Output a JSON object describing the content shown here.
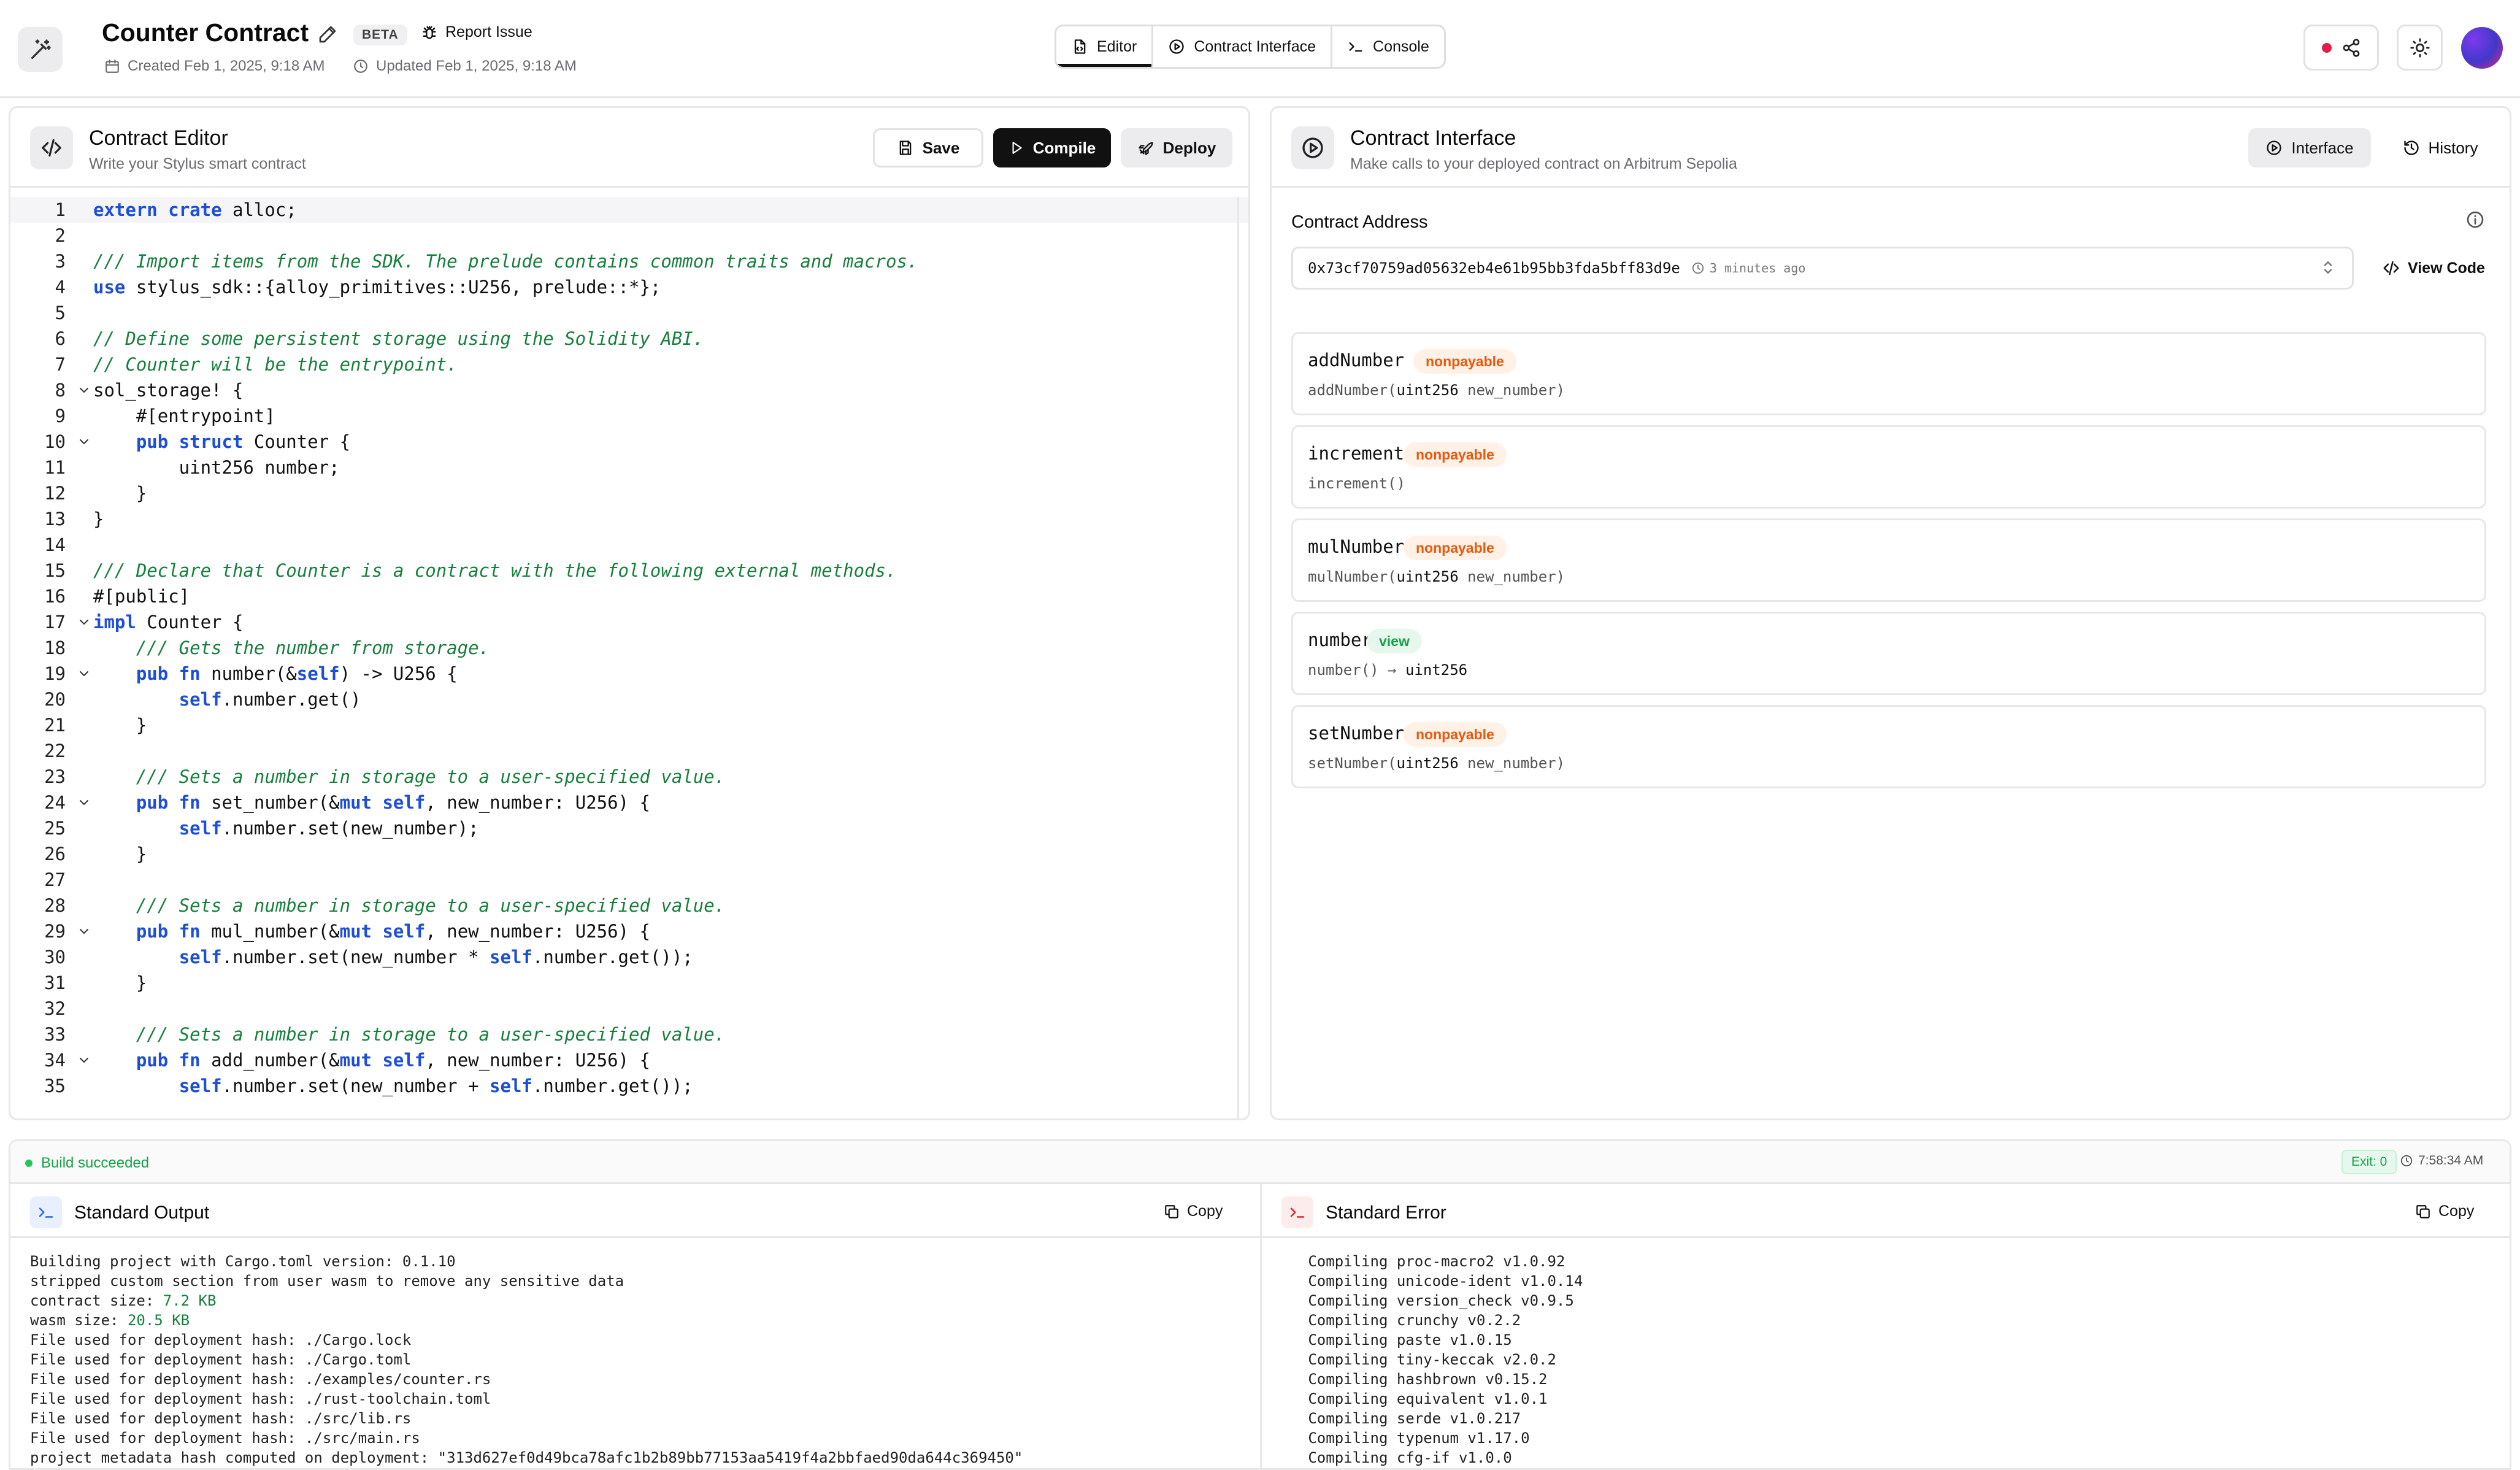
{
  "header": {
    "title": "Counter Contract",
    "beta": "BETA",
    "report_issue": "Report Issue",
    "created": "Created Feb 1, 2025, 9:18 AM",
    "updated": "Updated Feb 1, 2025, 9:18 AM",
    "tabs": [
      {
        "label": "Editor",
        "active": true
      },
      {
        "label": "Contract Interface",
        "active": false
      },
      {
        "label": "Console",
        "active": false
      }
    ]
  },
  "editor": {
    "title": "Contract Editor",
    "subtitle": "Write your Stylus smart contract",
    "save": "Save",
    "compile": "Compile",
    "deploy": "Deploy",
    "lines": [
      {
        "n": "1",
        "fold": false,
        "html": "<span class=\"kw\">extern</span> <span class=\"kw\">crate</span> alloc;"
      },
      {
        "n": "2",
        "fold": false,
        "html": ""
      },
      {
        "n": "3",
        "fold": false,
        "html": "<span class=\"cm\">/// Import items from the SDK. The prelude contains common traits and macros.</span>"
      },
      {
        "n": "4",
        "fold": false,
        "html": "<span class=\"kw\">use</span> stylus_sdk::{alloy_primitives::U256, prelude::*};"
      },
      {
        "n": "5",
        "fold": false,
        "html": ""
      },
      {
        "n": "6",
        "fold": false,
        "html": "<span class=\"cm\">// Define some persistent storage using the Solidity ABI.</span>"
      },
      {
        "n": "7",
        "fold": false,
        "html": "<span class=\"cm\">// Counter will be the entrypoint.</span>"
      },
      {
        "n": "8",
        "fold": true,
        "html": "sol_storage! {"
      },
      {
        "n": "9",
        "fold": false,
        "html": "    #[entrypoint]"
      },
      {
        "n": "10",
        "fold": true,
        "html": "    <span class=\"kw\">pub</span> <span class=\"kw\">struct</span> Counter {"
      },
      {
        "n": "11",
        "fold": false,
        "html": "        uint256 number;"
      },
      {
        "n": "12",
        "fold": false,
        "html": "    }"
      },
      {
        "n": "13",
        "fold": false,
        "html": "}"
      },
      {
        "n": "14",
        "fold": false,
        "html": ""
      },
      {
        "n": "15",
        "fold": false,
        "html": "<span class=\"cm\">/// Declare that Counter is a contract with the following external methods.</span>"
      },
      {
        "n": "16",
        "fold": false,
        "html": "#[public]"
      },
      {
        "n": "17",
        "fold": true,
        "html": "<span class=\"kw\">impl</span> Counter {"
      },
      {
        "n": "18",
        "fold": false,
        "html": "    <span class=\"cm\">/// Gets the number from storage.</span>"
      },
      {
        "n": "19",
        "fold": true,
        "html": "    <span class=\"kw\">pub</span> <span class=\"kw\">fn</span> number(&amp;<span class=\"kw\">self</span>) -&gt; U256 {"
      },
      {
        "n": "20",
        "fold": false,
        "html": "        <span class=\"kw\">self</span>.number.get()"
      },
      {
        "n": "21",
        "fold": false,
        "html": "    }"
      },
      {
        "n": "22",
        "fold": false,
        "html": ""
      },
      {
        "n": "23",
        "fold": false,
        "html": "    <span class=\"cm\">/// Sets a number in storage to a user-specified value.</span>"
      },
      {
        "n": "24",
        "fold": true,
        "html": "    <span class=\"kw\">pub</span> <span class=\"kw\">fn</span> set_number(&amp;<span class=\"kw\">mut</span> <span class=\"kw\">self</span>, new_number: U256) {"
      },
      {
        "n": "25",
        "fold": false,
        "html": "        <span class=\"kw\">self</span>.number.set(new_number);"
      },
      {
        "n": "26",
        "fold": false,
        "html": "    }"
      },
      {
        "n": "27",
        "fold": false,
        "html": ""
      },
      {
        "n": "28",
        "fold": false,
        "html": "    <span class=\"cm\">/// Sets a number in storage to a user-specified value.</span>"
      },
      {
        "n": "29",
        "fold": true,
        "html": "    <span class=\"kw\">pub</span> <span class=\"kw\">fn</span> mul_number(&amp;<span class=\"kw\">mut</span> <span class=\"kw\">self</span>, new_number: U256) {"
      },
      {
        "n": "30",
        "fold": false,
        "html": "        <span class=\"kw\">self</span>.number.set(new_number * <span class=\"kw\">self</span>.number.get());"
      },
      {
        "n": "31",
        "fold": false,
        "html": "    }"
      },
      {
        "n": "32",
        "fold": false,
        "html": ""
      },
      {
        "n": "33",
        "fold": false,
        "html": "    <span class=\"cm\">/// Sets a number in storage to a user-specified value.</span>"
      },
      {
        "n": "34",
        "fold": true,
        "html": "    <span class=\"kw\">pub</span> <span class=\"kw\">fn</span> add_number(&amp;<span class=\"kw\">mut</span> <span class=\"kw\">self</span>, new_number: U256) {"
      },
      {
        "n": "35",
        "fold": false,
        "html": "        <span class=\"kw\">self</span>.number.set(new_number + <span class=\"kw\">self</span>.number.get());"
      }
    ]
  },
  "interface": {
    "title": "Contract Interface",
    "subtitle": "Make calls to your deployed contract on Arbitrum Sepolia",
    "interface_btn": "Interface",
    "history_btn": "History",
    "address_label": "Contract Address",
    "address": "0x73cf70759ad05632eb4e61b95bb3fda5bff83d9e",
    "address_ago": "3 minutes ago",
    "view_code": "View Code",
    "functions": [
      {
        "name": "addNumber",
        "badge": "nonpayable",
        "sig_html": "addNumber(<b>uint256</b> new_number)"
      },
      {
        "name": "increment",
        "badge": "nonpayable",
        "sig_html": "increment()"
      },
      {
        "name": "mulNumber",
        "badge": "nonpayable",
        "sig_html": "mulNumber(<b>uint256</b> new_number)"
      },
      {
        "name": "number",
        "badge": "view",
        "sig_html": "number() → <b>uint256</b>"
      },
      {
        "name": "setNumber",
        "badge": "nonpayable",
        "sig_html": "setNumber(<b>uint256</b> new_number)"
      }
    ]
  },
  "console": {
    "status": "Build succeeded",
    "exit": "Exit: 0",
    "time": "7:58:34 AM",
    "stdout_title": "Standard Output",
    "stderr_title": "Standard Error",
    "copy": "Copy",
    "stdout_lines": [
      "Building project with Cargo.toml version: 0.1.10",
      "stripped custom section from user wasm to remove any sensitive data",
      "contract size: <span class=\"gr\">7.2 KB</span>",
      "wasm size: <span class=\"gr\">20.5 KB</span>",
      "File used for deployment hash: ./Cargo.lock",
      "File used for deployment hash: ./Cargo.toml",
      "File used for deployment hash: ./examples/counter.rs",
      "File used for deployment hash: ./rust-toolchain.toml",
      "File used for deployment hash: ./src/lib.rs",
      "File used for deployment hash: ./src/main.rs",
      "project metadata hash computed on deployment: \"313d627ef0d49bca78afc1b2b89bb77153aa5419f4a2bbfaed90da644c369450\""
    ],
    "stderr_lines": [
      "   Compiling proc-macro2 v1.0.92",
      "   Compiling unicode-ident v1.0.14",
      "   Compiling version_check v0.9.5",
      "   Compiling crunchy v0.2.2",
      "   Compiling paste v1.0.15",
      "   Compiling tiny-keccak v2.0.2",
      "   Compiling hashbrown v0.15.2",
      "   Compiling equivalent v1.0.1",
      "   Compiling serde v1.0.217",
      "   Compiling typenum v1.17.0",
      "   Compiling cfg-if v1.0.0"
    ]
  }
}
